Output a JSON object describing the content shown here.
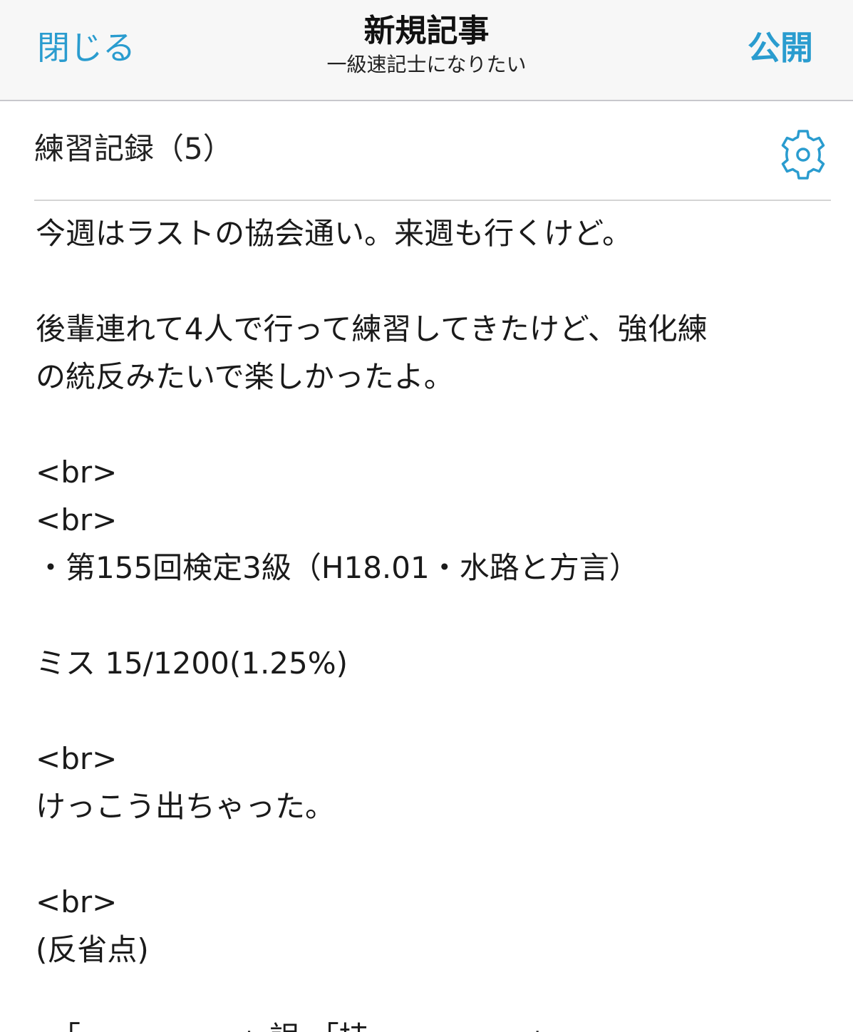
{
  "nav": {
    "close_label": "閉じる",
    "title": "新規記事",
    "subtitle": "一級速記士になりたい",
    "publish_label": "公開"
  },
  "entry": {
    "title": "練習記録（5）",
    "settings_icon": "gear-icon",
    "body_lines": [
      "今週はラストの協会通い。来週も行くけど。",
      "",
      "後輩連れて4人で行って練習してきたけど、強化練",
      "の統反みたいで楽しかったよ。",
      "",
      "<br>",
      "<br>",
      "・第155回検定3級（H18.01・水路と方言）",
      "",
      "ミス 15/1200(1.25%)",
      "",
      "<br>",
      "けっこう出ちゃった。",
      "",
      "<br>",
      "(反省点)",
      ""
    ],
    "cutoff_line": "・「 　　　　　」誤 「持 　　　　　」"
  },
  "colors": {
    "accent": "#2a9ccf",
    "nav_background": "#f7f7f7",
    "separator": "#c8c8cc"
  }
}
